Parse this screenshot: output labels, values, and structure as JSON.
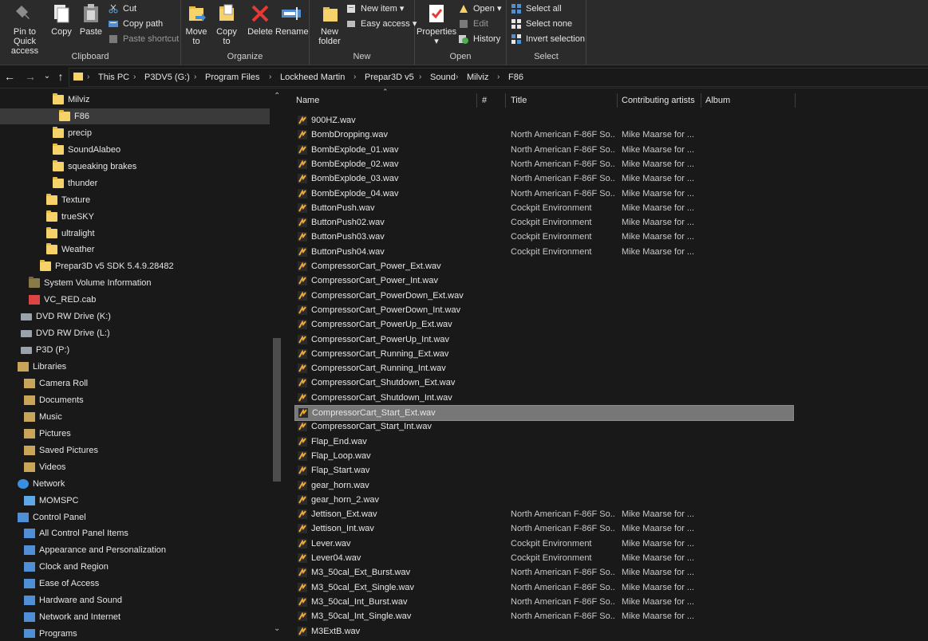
{
  "ribbon": {
    "clipboard": {
      "label": "Clipboard",
      "pin": "Pin to Quick access",
      "copy": "Copy",
      "paste": "Paste",
      "cut": "Cut",
      "copy_path": "Copy path",
      "paste_shortcut": "Paste shortcut"
    },
    "organize": {
      "label": "Organize",
      "move_to": "Move to",
      "copy_to": "Copy to",
      "delete": "Delete",
      "rename": "Rename"
    },
    "new": {
      "label": "New",
      "new_folder": "New folder",
      "new_item": "New item",
      "easy_access": "Easy access"
    },
    "open": {
      "label": "Open",
      "properties": "Properties",
      "open": "Open",
      "edit": "Edit",
      "history": "History"
    },
    "select": {
      "label": "Select",
      "select_all": "Select all",
      "select_none": "Select none",
      "invert": "Invert selection"
    }
  },
  "address": {
    "crumbs": [
      "This PC",
      "P3DV5 (G:)",
      "Program Files",
      "Lockheed Martin",
      "Prepar3D v5",
      "Sound",
      "Milviz",
      "F86"
    ]
  },
  "nav": {
    "items": [
      {
        "label": "Milviz",
        "icon": "folder-icon",
        "selected": false
      },
      {
        "label": "F86",
        "icon": "folder-icon",
        "selected": true
      },
      {
        "label": "precip",
        "icon": "folder-icon",
        "selected": false
      },
      {
        "label": "SoundAlabeo",
        "icon": "folder-icon",
        "selected": false
      },
      {
        "label": "squeaking brakes",
        "icon": "folder-icon",
        "selected": false
      },
      {
        "label": "thunder",
        "icon": "folder-icon",
        "selected": false
      },
      {
        "label": "Texture",
        "icon": "folder-icon",
        "selected": false
      },
      {
        "label": "trueSKY",
        "icon": "folder-icon",
        "selected": false
      },
      {
        "label": "ultralight",
        "icon": "folder-icon",
        "selected": false
      },
      {
        "label": "Weather",
        "icon": "folder-icon",
        "selected": false
      },
      {
        "label": "Prepar3D v5 SDK 5.4.9.28482",
        "icon": "folder-icon",
        "selected": false
      },
      {
        "label": "System Volume Information",
        "icon": "locked-folder-icon",
        "selected": false
      },
      {
        "label": "VC_RED.cab",
        "icon": "cab-file-icon",
        "selected": false
      },
      {
        "label": "DVD RW Drive (K:)",
        "icon": "dvd-drive-icon",
        "selected": false
      },
      {
        "label": "DVD RW Drive (L:)",
        "icon": "dvd-drive-icon",
        "selected": false
      },
      {
        "label": "P3D (P:)",
        "icon": "network-drive-icon",
        "selected": false
      },
      {
        "label": "Libraries",
        "icon": "libraries-icon",
        "selected": false
      },
      {
        "label": "Camera Roll",
        "icon": "library-folder-icon",
        "selected": false
      },
      {
        "label": "Documents",
        "icon": "library-folder-icon",
        "selected": false
      },
      {
        "label": "Music",
        "icon": "library-folder-icon",
        "selected": false
      },
      {
        "label": "Pictures",
        "icon": "library-folder-icon",
        "selected": false
      },
      {
        "label": "Saved Pictures",
        "icon": "library-folder-icon",
        "selected": false
      },
      {
        "label": "Videos",
        "icon": "library-folder-icon",
        "selected": false
      },
      {
        "label": "Network",
        "icon": "network-icon",
        "selected": false
      },
      {
        "label": "MOMSPC",
        "icon": "computer-icon",
        "selected": false
      },
      {
        "label": "Control Panel",
        "icon": "control-panel-icon",
        "selected": false
      },
      {
        "label": "All Control Panel Items",
        "icon": "control-panel-icon",
        "selected": false
      },
      {
        "label": "Appearance and Personalization",
        "icon": "control-panel-icon",
        "selected": false
      },
      {
        "label": "Clock and Region",
        "icon": "control-panel-icon",
        "selected": false
      },
      {
        "label": "Ease of Access",
        "icon": "control-panel-icon",
        "selected": false
      },
      {
        "label": "Hardware and Sound",
        "icon": "control-panel-icon",
        "selected": false
      },
      {
        "label": "Network and Internet",
        "icon": "control-panel-icon",
        "selected": false
      },
      {
        "label": "Programs",
        "icon": "control-panel-icon",
        "selected": false
      }
    ]
  },
  "columns": {
    "name": "Name",
    "number": "#",
    "title": "Title",
    "artists": "Contributing artists",
    "album": "Album"
  },
  "files": [
    {
      "name": "900HZ.wav",
      "title": "",
      "artist": ""
    },
    {
      "name": "BombDropping.wav",
      "title": "North American F-86F So...",
      "artist": "Mike Maarse for ..."
    },
    {
      "name": "BombExplode_01.wav",
      "title": "North American F-86F So...",
      "artist": "Mike Maarse for ..."
    },
    {
      "name": "BombExplode_02.wav",
      "title": "North American F-86F So...",
      "artist": "Mike Maarse for ..."
    },
    {
      "name": "BombExplode_03.wav",
      "title": "North American F-86F So...",
      "artist": "Mike Maarse for ..."
    },
    {
      "name": "BombExplode_04.wav",
      "title": "North American F-86F So...",
      "artist": "Mike Maarse for ..."
    },
    {
      "name": "ButtonPush.wav",
      "title": "Cockpit Environment",
      "artist": "Mike Maarse for ..."
    },
    {
      "name": "ButtonPush02.wav",
      "title": "Cockpit Environment",
      "artist": "Mike Maarse for ..."
    },
    {
      "name": "ButtonPush03.wav",
      "title": "Cockpit Environment",
      "artist": "Mike Maarse for ..."
    },
    {
      "name": "ButtonPush04.wav",
      "title": "Cockpit Environment",
      "artist": "Mike Maarse for ..."
    },
    {
      "name": "CompressorCart_Power_Ext.wav",
      "title": "",
      "artist": ""
    },
    {
      "name": "CompressorCart_Power_Int.wav",
      "title": "",
      "artist": ""
    },
    {
      "name": "CompressorCart_PowerDown_Ext.wav",
      "title": "",
      "artist": ""
    },
    {
      "name": "CompressorCart_PowerDown_Int.wav",
      "title": "",
      "artist": ""
    },
    {
      "name": "CompressorCart_PowerUp_Ext.wav",
      "title": "",
      "artist": ""
    },
    {
      "name": "CompressorCart_PowerUp_Int.wav",
      "title": "",
      "artist": ""
    },
    {
      "name": "CompressorCart_Running_Ext.wav",
      "title": "",
      "artist": ""
    },
    {
      "name": "CompressorCart_Running_Int.wav",
      "title": "",
      "artist": ""
    },
    {
      "name": "CompressorCart_Shutdown_Ext.wav",
      "title": "",
      "artist": ""
    },
    {
      "name": "CompressorCart_Shutdown_Int.wav",
      "title": "",
      "artist": ""
    },
    {
      "name": "CompressorCart_Start_Ext.wav",
      "title": "",
      "artist": "",
      "selected": true
    },
    {
      "name": "CompressorCart_Start_Int.wav",
      "title": "",
      "artist": ""
    },
    {
      "name": "Flap_End.wav",
      "title": "",
      "artist": ""
    },
    {
      "name": "Flap_Loop.wav",
      "title": "",
      "artist": ""
    },
    {
      "name": "Flap_Start.wav",
      "title": "",
      "artist": ""
    },
    {
      "name": "gear_horn.wav",
      "title": "",
      "artist": ""
    },
    {
      "name": "gear_horn_2.wav",
      "title": "",
      "artist": ""
    },
    {
      "name": "Jettison_Ext.wav",
      "title": "North American F-86F So...",
      "artist": "Mike Maarse for ..."
    },
    {
      "name": "Jettison_Int.wav",
      "title": "North American F-86F So...",
      "artist": "Mike Maarse for ..."
    },
    {
      "name": "Lever.wav",
      "title": "Cockpit Environment",
      "artist": "Mike Maarse for ..."
    },
    {
      "name": "Lever04.wav",
      "title": "Cockpit Environment",
      "artist": "Mike Maarse for ..."
    },
    {
      "name": "M3_50cal_Ext_Burst.wav",
      "title": "North American F-86F So...",
      "artist": "Mike Maarse for ..."
    },
    {
      "name": "M3_50cal_Ext_Single.wav",
      "title": "North American F-86F So...",
      "artist": "Mike Maarse for ..."
    },
    {
      "name": "M3_50cal_Int_Burst.wav",
      "title": "North American F-86F So...",
      "artist": "Mike Maarse for ..."
    },
    {
      "name": "M3_50cal_Int_Single.wav",
      "title": "North American F-86F So...",
      "artist": "Mike Maarse for ..."
    },
    {
      "name": "M3ExtB.wav",
      "title": "",
      "artist": ""
    }
  ]
}
